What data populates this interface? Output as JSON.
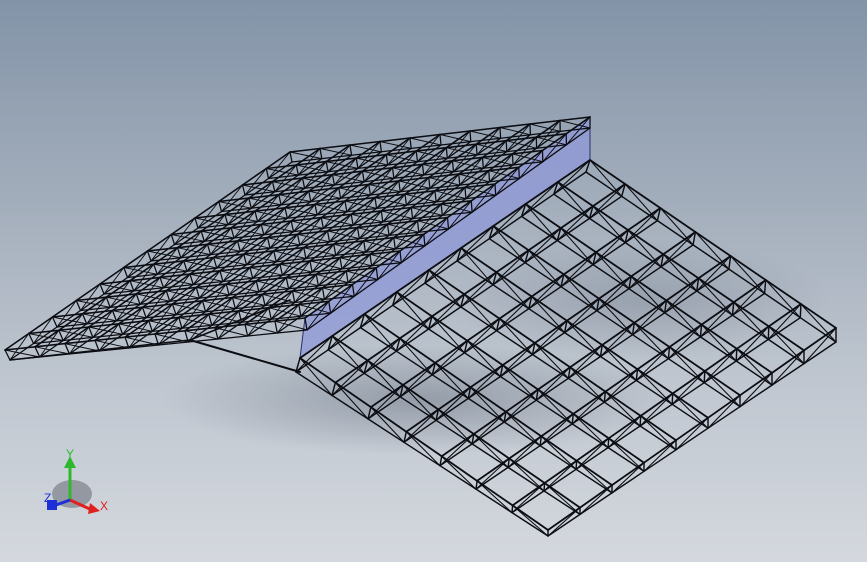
{
  "viewport": {
    "model": "space-frame-roof"
  },
  "triad": {
    "x_label": "X",
    "y_label": "Y",
    "z_label": "Z",
    "x_color": "#e0201c",
    "y_color": "#2eb82e",
    "z_color": "#1d2fd6"
  },
  "colors": {
    "frame": "#0b0d12",
    "panel": "#8f98d8",
    "panel_edge": "#2a2f6a"
  }
}
